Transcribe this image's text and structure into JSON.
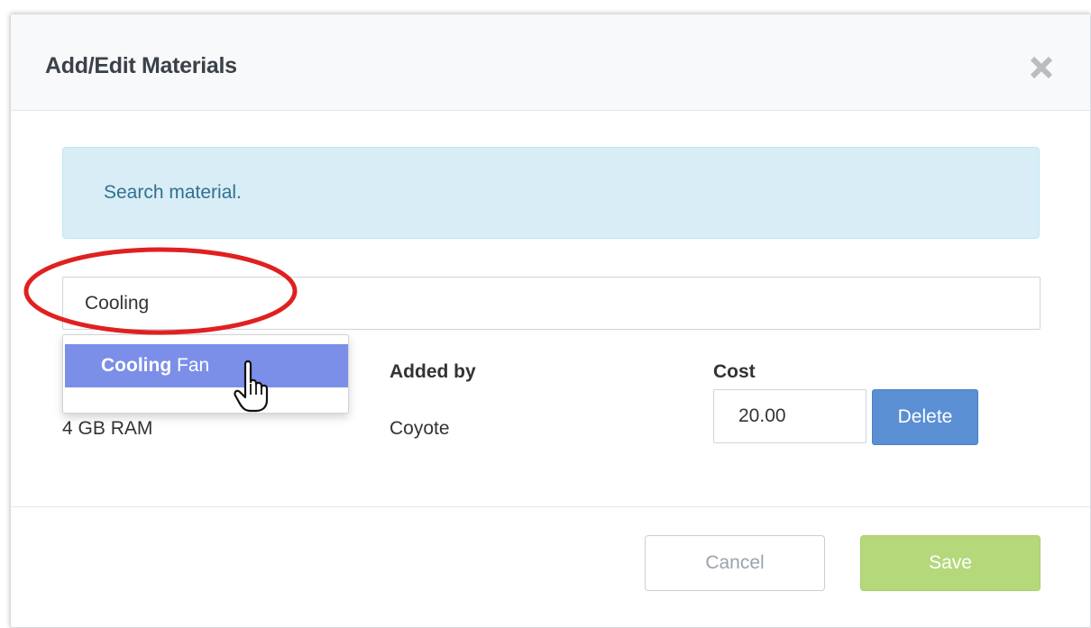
{
  "modal": {
    "title": "Add/Edit Materials",
    "info": "Search material."
  },
  "search": {
    "value": "Cooling"
  },
  "suggestion": {
    "match": "Cooling",
    "rest": " Fan"
  },
  "table": {
    "headers": {
      "added_by": "Added by",
      "cost": "Cost"
    },
    "rows": [
      {
        "name": "4 GB RAM",
        "added_by": "Coyote",
        "cost": "20.00",
        "delete_label": "Delete"
      }
    ]
  },
  "footer": {
    "cancel_label": "Cancel",
    "save_label": "Save"
  },
  "colors": {
    "info_bg": "#d9edf7",
    "dropdown_highlight": "#7b8fe8",
    "delete_button": "#5b8fd4",
    "save_button": "#b5d87a",
    "annotation_red": "#e02020"
  },
  "icons": {
    "close": "close-icon",
    "cursor": "hand-cursor-icon"
  }
}
